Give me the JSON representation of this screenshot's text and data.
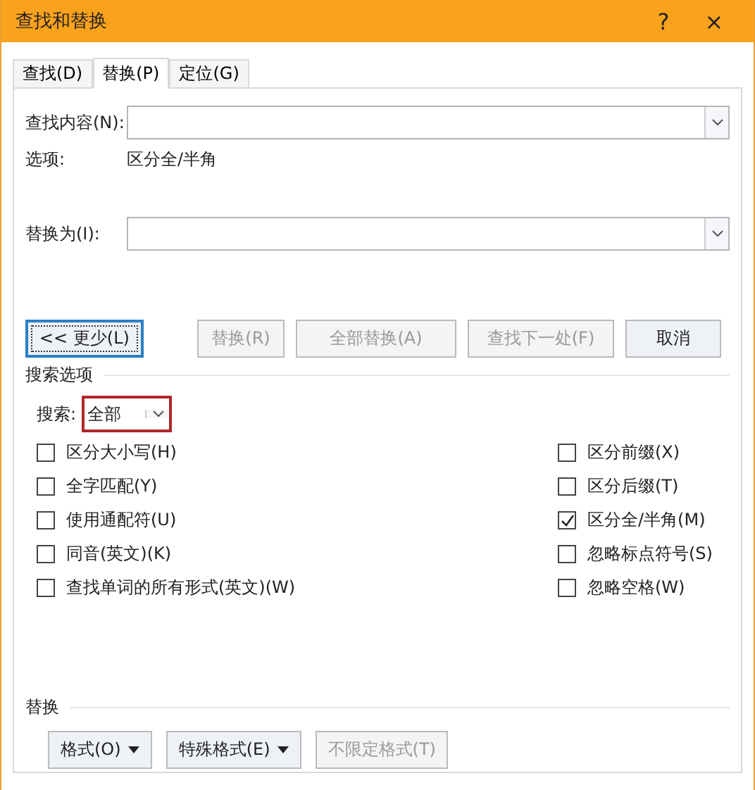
{
  "window": {
    "title": "查找和替换"
  },
  "title_buttons": [
    "?",
    "×"
  ],
  "tabs": [
    {
      "label": "查找(D)",
      "selected": false
    },
    {
      "label": "替换(P)",
      "selected": true
    },
    {
      "label": "定位(G)",
      "selected": false
    }
  ],
  "find": {
    "label": "查找内容(N):"
  },
  "options": {
    "label": "选项:",
    "value": "区分全/半角"
  },
  "replace": {
    "label": "替换为(I):"
  },
  "action_buttons": [
    {
      "label": "<< 更少(L)",
      "disabled": false,
      "focused": true
    },
    {
      "label": "替换(R)",
      "disabled": true,
      "focused": false
    },
    {
      "label": "全部替换(A)",
      "disabled": true,
      "focused": false
    },
    {
      "label": "查找下一处(F)",
      "disabled": true,
      "focused": false
    },
    {
      "label": "取消",
      "disabled": false,
      "focused": false
    }
  ],
  "search_options": {
    "heading": "搜索选项",
    "search_label": "搜索:",
    "search_value": "全部"
  },
  "left_checks": [
    {
      "label": "区分大小写(H)",
      "checked": false
    },
    {
      "label": "全字匹配(Y)",
      "checked": false
    },
    {
      "label": "使用通配符(U)",
      "checked": false
    },
    {
      "label": "同音(英文)(K)",
      "checked": false
    },
    {
      "label": "查找单词的所有形式(英文)(W)",
      "checked": false
    }
  ],
  "right_checks": [
    {
      "label": "区分前缀(X)",
      "checked": false
    },
    {
      "label": "区分后缀(T)",
      "checked": false
    },
    {
      "label": "区分全/半角(M)",
      "checked": true
    },
    {
      "label": "忽略标点符号(S)",
      "checked": false
    },
    {
      "label": "忽略空格(W)",
      "checked": false
    }
  ],
  "replace_section": {
    "heading": "替换"
  },
  "format_buttons": [
    {
      "label": "格式(O)",
      "kind": "menu",
      "disabled": false
    },
    {
      "label": "特殊格式(E)",
      "kind": "menu",
      "disabled": false
    },
    {
      "label": "不限定格式(T)",
      "kind": "plain",
      "disabled": true
    }
  ]
}
